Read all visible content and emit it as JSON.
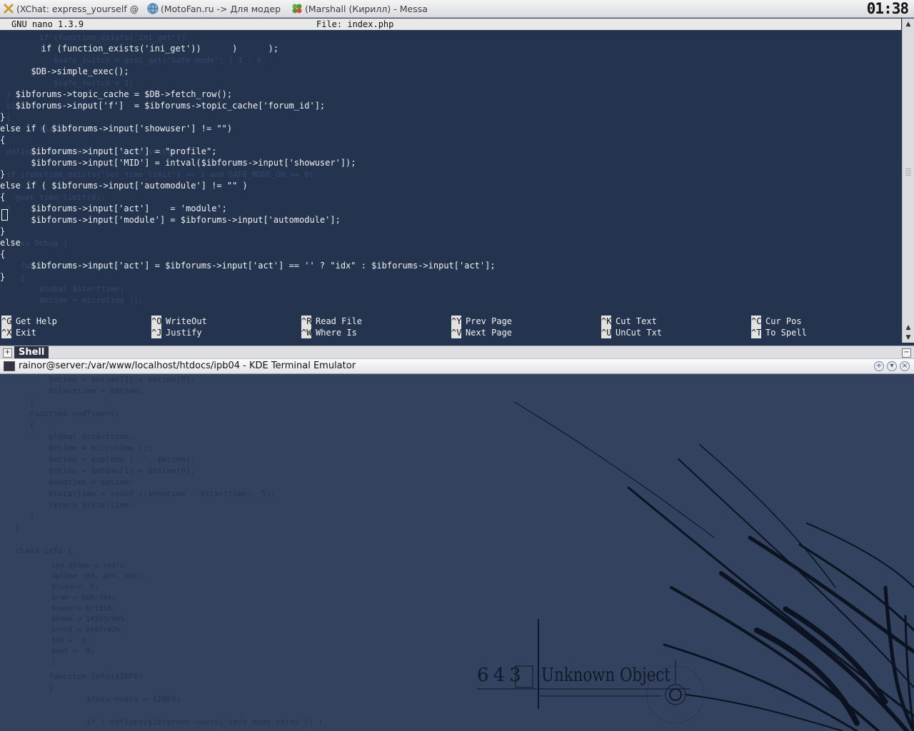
{
  "taskbar": {
    "tasks": [
      {
        "label": "(XChat: express_yourself @",
        "icon": "xchat-icon"
      },
      {
        "label": "(MotoFan.ru -> Для модер",
        "icon": "browser-icon"
      },
      {
        "label": "(Marshall (Кирилл) - Messa",
        "icon": "messenger-icon"
      }
    ],
    "clock": "01:38"
  },
  "nano": {
    "version": "GNU nano 1.3.9",
    "file": "File: index.php",
    "lines": [
      "        if (function_exists('ini_get'))      )      );",
      "",
      "      $DB->simple_exec();",
      "",
      "   $ibforums->topic_cache = $DB->fetch_row();",
      "   $ibforums->input['f']  = $ibforums->topic_cache['forum_id'];",
      "}",
      "else if ( $ibforums->input['showuser'] != \"\")",
      "{",
      "      $ibforums->input['act'] = \"profile\";",
      "      $ibforums->input['MID'] = intval($ibforums->input['showuser']);",
      "}",
      "else if ( $ibforums->input['automodule'] != \"\" )",
      "{",
      "      $ibforums->input['act']    = 'module';",
      "      $ibforums->input['module'] = $ibforums->input['automodule'];",
      "}",
      "else",
      "{",
      "      $ibforums->input['act'] = $ibforums->input['act'] == '' ? \"idx\" : $ibforums->input['act'];",
      "}"
    ],
    "shortcuts": [
      [
        {
          "key": "^G",
          "label": "Get Help"
        },
        {
          "key": "^O",
          "label": "WriteOut"
        },
        {
          "key": "^R",
          "label": "Read File"
        },
        {
          "key": "^Y",
          "label": "Prev Page"
        },
        {
          "key": "^K",
          "label": "Cut Text"
        },
        {
          "key": "^C",
          "label": "Cur Pos"
        }
      ],
      [
        {
          "key": "^X",
          "label": "Exit"
        },
        {
          "key": "^J",
          "label": "Justify"
        },
        {
          "key": "^W",
          "label": "Where Is"
        },
        {
          "key": "^V",
          "label": "Next Page"
        },
        {
          "key": "^U",
          "label": "UnCut Txt"
        },
        {
          "key": "^T",
          "label": "To Spell"
        }
      ]
    ]
  },
  "konsole": {
    "tab_label": "Shell",
    "window_title": "rainor@server:/var/www/localhost/htdocs/ipb04 - KDE Terminal Emulator"
  },
  "wallpaper": {
    "ghost_code": [
      "        if (function_exists('ini_get'))",
      "        {",
      "           $safe_switch = @ini_get(\"safe_mode\") ? 1 : 0;",
      "        }",
      "           $safe_switch = 1;",
      " }",
      " else",
      " {",
      "        $safe_switch = 1;",
      "",
      " define( 'SAFE_MODE_ON', $safe_switch );",
      "",
      " if (function_exists('set_time_limit') == 1 and SAFE_MODE_ON == 0)",
      " {",
      "   @set_time_limit(0);",
      " }",
      "",
      "",
      " class Debug {",
      "",
      "    function startTimer()",
      "    {",
      "        global $starttime;",
      "        $mtime = microtime ();"
    ],
    "code_lines": [
      "        $mtime = $mtime[1] + $mtime[0];",
      "        $starttime = $mtime;",
      "    }",
      "    function endTimer()",
      "    {",
      "        global $starttime;",
      "        $mtime = microtime ();",
      "        $mtime = explode (' ', $mtime);",
      "        $mtime = $mtime[1] + $mtime[0];",
      "        $endtime = $mtime;",
      "        $totaltime = round (($endtime - $starttime), 5);",
      "        return $totaltime;",
      "    }",
      " }",
      "",
      " class info {"
    ],
    "stats_lines": [
      "cpu $temp = +49°C",
      "uptime (0d, 02h, 08m);",
      "$load =  0;",
      "$ram = 488/504;",
      "$swap = 0/1153;",
      "$home = 14303/60%;",
      "$root = 8407/42%;",
      "$in =  0;",
      "$out =  0;",
      "}"
    ],
    "code_tail": [
      "        function info($INFO)",
      "        {",
      "                $this->vars = $INFO;",
      "",
      "                if ( defined($ibforums->vars['safe_mode_skins']) )"
    ],
    "logo_number": "643",
    "logo_text": "Unknown Object"
  }
}
